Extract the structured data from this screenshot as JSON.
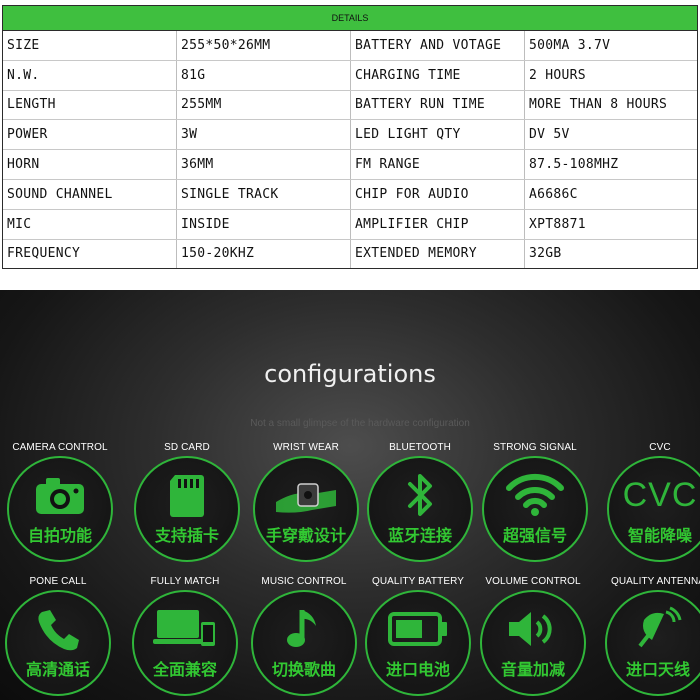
{
  "spec_table": {
    "header": "DETAILS",
    "rows": [
      {
        "k1": "SIZE",
        "v1": "255*50*26MM",
        "k2": "BATTERY AND VOTAGE",
        "v2": "500MA  3.7V"
      },
      {
        "k1": "N.W.",
        "v1": "81G",
        "k2": "CHARGING TIME",
        "v2": "2 HOURS"
      },
      {
        "k1": "LENGTH",
        "v1": "255MM",
        "k2": "BATTERY RUN TIME",
        "v2": "MORE THAN 8 HOURS"
      },
      {
        "k1": "POWER",
        "v1": "3W",
        "k2": "LED LIGHT QTY",
        "v2": "DV 5V"
      },
      {
        "k1": "HORN",
        "v1": "36MM",
        "k2": "FM RANGE",
        "v2": "87.5-108MHZ"
      },
      {
        "k1": "SOUND CHANNEL",
        "v1": "SINGLE TRACK",
        "k2": "CHIP FOR AUDIO",
        "v2": "A6686C"
      },
      {
        "k1": "MIC",
        "v1": "INSIDE",
        "k2": "AMPLIFIER CHIP",
        "v2": "XPT8871"
      },
      {
        "k1": "FREQUENCY",
        "v1": "150-20KHZ",
        "k2": "EXTENDED MEMORY",
        "v2": "32GB"
      }
    ]
  },
  "configurations": {
    "title": "configurations",
    "subtitle": "Not a small glimpse of the hardware configuration",
    "features": [
      {
        "label": "CAMERA CONTROL",
        "zh": "自拍功能",
        "icon": "camera-icon"
      },
      {
        "label": "SD CARD",
        "zh": "支持插卡",
        "icon": "sd-card-icon"
      },
      {
        "label": "WRIST WEAR",
        "zh": "手穿戴设计",
        "icon": "watch-icon"
      },
      {
        "label": "BLUETOOTH",
        "zh": "蓝牙连接",
        "icon": "bluetooth-icon"
      },
      {
        "label": "STRONG SIGNAL",
        "zh": "超强信号",
        "icon": "wifi-icon"
      },
      {
        "label": "CVC",
        "zh": "智能降噪",
        "icon": "cvc-icon",
        "icon_text": "CVC"
      },
      {
        "label": "PONE CALL",
        "zh": "高清通话",
        "icon": "phone-icon"
      },
      {
        "label": "FULLY MATCH",
        "zh": "全面兼容",
        "icon": "devices-icon"
      },
      {
        "label": "MUSIC CONTROL",
        "zh": "切换歌曲",
        "icon": "music-note-icon"
      },
      {
        "label": "QUALITY BATTERY",
        "zh": "进口电池",
        "icon": "battery-icon"
      },
      {
        "label": "VOLUME CONTROL",
        "zh": "音量加减",
        "icon": "speaker-icon"
      },
      {
        "label": "QUALITY ANTENNA",
        "zh": "进口天线",
        "icon": "antenna-icon"
      }
    ]
  },
  "colors": {
    "header_green": "#3fbf3f",
    "accent_green": "#32c832",
    "panel_dark": "#1a1a1a"
  }
}
